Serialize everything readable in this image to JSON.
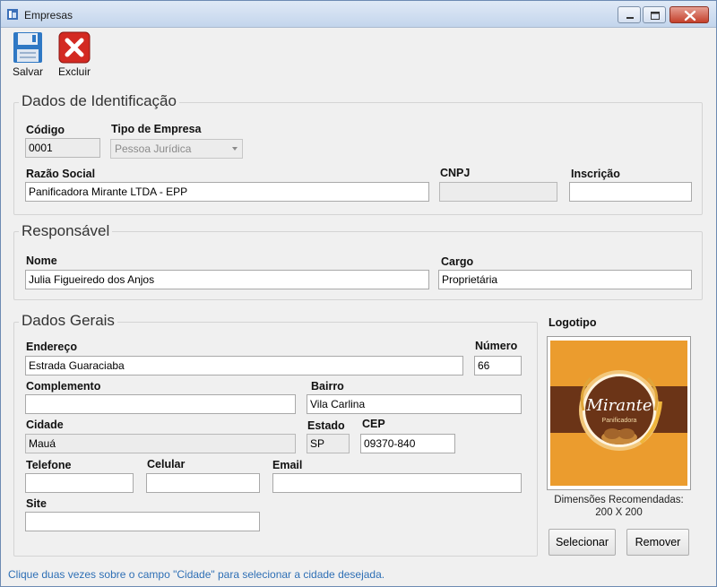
{
  "window": {
    "title": "Empresas"
  },
  "toolbar": {
    "save_label": "Salvar",
    "delete_label": "Excluir"
  },
  "identificacao": {
    "title": "Dados de Identificação",
    "codigo_label": "Código",
    "codigo_value": "0001",
    "tipo_label": "Tipo de Empresa",
    "tipo_value": "Pessoa Jurídica",
    "razao_label": "Razão Social",
    "razao_value": "Panificadora Mirante LTDA - EPP",
    "cnpj_label": "CNPJ",
    "cnpj_value": "",
    "inscricao_label": "Inscrição",
    "inscricao_value": ""
  },
  "responsavel": {
    "title": "Responsável",
    "nome_label": "Nome",
    "nome_value": "Julia Figueiredo dos Anjos",
    "cargo_label": "Cargo",
    "cargo_value": "Proprietária"
  },
  "gerais": {
    "title": "Dados Gerais",
    "endereco_label": "Endereço",
    "endereco_value": "Estrada Guaraciaba",
    "numero_label": "Número",
    "numero_value": "66",
    "complemento_label": "Complemento",
    "complemento_value": "",
    "bairro_label": "Bairro",
    "bairro_value": "Vila Carlina",
    "cidade_label": "Cidade",
    "cidade_value": "Mauá",
    "estado_label": "Estado",
    "estado_value": "SP",
    "cep_label": "CEP",
    "cep_value": "09370-840",
    "telefone_label": "Telefone",
    "telefone_value": "",
    "celular_label": "Celular",
    "celular_value": "",
    "email_label": "Email",
    "email_value": "",
    "site_label": "Site",
    "site_value": ""
  },
  "logo": {
    "title": "Logotipo",
    "brand_name": "Mirante",
    "brand_sub": "Panificadora",
    "dims_line1": "Dimensões Recomendadas:",
    "dims_line2": "200 X 200",
    "select_label": "Selecionar",
    "remove_label": "Remover"
  },
  "status": {
    "text": "Clique duas vezes sobre o campo \"Cidade\" para selecionar a cidade desejada."
  },
  "colors": {
    "accent": "#2e6fb5",
    "close": "#c4402b",
    "logo_orange": "#e8982a",
    "logo_brown": "#5b2e12"
  }
}
